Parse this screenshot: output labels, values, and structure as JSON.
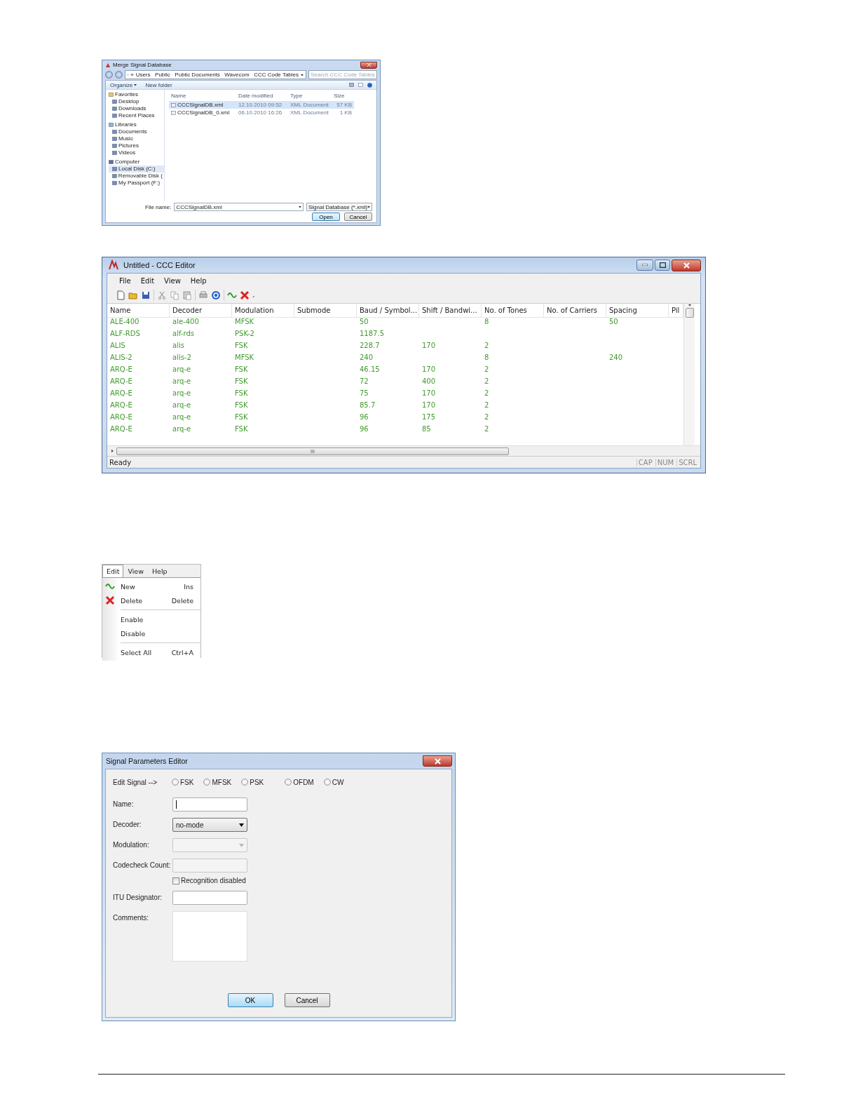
{
  "merge_dialog": {
    "title": "Merge Signal Database",
    "path": [
      "«",
      "Users",
      "Public",
      "Public Documents",
      "Wavecom",
      "CCC Code Tables"
    ],
    "search": {
      "placeholder": "Search CCC Code Tables"
    },
    "toolbar": [
      "Organize",
      "New folder"
    ],
    "nav": [
      {
        "label": "Favorites",
        "children": [
          {
            "label": "Desktop",
            "selected": false
          },
          {
            "label": "Downloads",
            "selected": false
          },
          {
            "label": "Recent Places",
            "selected": false
          }
        ]
      },
      {
        "label": "Libraries",
        "children": [
          {
            "label": "Documents",
            "selected": false
          },
          {
            "label": "Music",
            "selected": false
          },
          {
            "label": "Pictures",
            "selected": false
          },
          {
            "label": "Videos",
            "selected": false
          }
        ]
      },
      {
        "label": "Computer",
        "children": [
          {
            "label": "Local Disk (C:)",
            "selected": true
          },
          {
            "label": "Removable Disk (",
            "selected": false
          },
          {
            "label": "My Passport (F:)",
            "selected": false
          }
        ]
      }
    ],
    "columns": [
      "Name",
      "Date modified",
      "Type",
      "Size"
    ],
    "files": [
      {
        "name": "CCCSignalDB.xml",
        "date": "12.10.2010 09:52",
        "type": "XML Document",
        "size": "57 KB",
        "selected": true
      },
      {
        "name": "CCCSignalDB_0.xml",
        "date": "06.10.2010 16:26",
        "type": "XML Document",
        "size": "1 KB",
        "selected": false
      }
    ],
    "file_name_label": "File name:",
    "file_name": "CCCSignalDB.xml",
    "file_type": "Signal Database (*.xml)",
    "buttons": [
      "Open",
      "Cancel"
    ]
  },
  "editor": {
    "title": "Untitled - CCC Editor",
    "menu": [
      "File",
      "Edit",
      "View",
      "Help"
    ],
    "columns": [
      "Name",
      "Decoder",
      "Modulation",
      "Submode",
      "Baud / Symbol...",
      "Shift / Bandwi...",
      "No. of Tones",
      "No. of Carriers",
      "Spacing",
      "Pil"
    ],
    "rows": [
      [
        "ALE-400",
        "ale-400",
        "MFSK",
        "",
        "50",
        "",
        "8",
        "",
        "50",
        ""
      ],
      [
        "ALF-RDS",
        "alf-rds",
        "PSK-2",
        "",
        "1187.5",
        "",
        "",
        "",
        "",
        ""
      ],
      [
        "ALIS",
        "alis",
        "FSK",
        "",
        "228.7",
        "170",
        "2",
        "",
        "",
        ""
      ],
      [
        "ALIS-2",
        "alis-2",
        "MFSK",
        "",
        "240",
        "",
        "8",
        "",
        "240",
        ""
      ],
      [
        "ARQ-E",
        "arq-e",
        "FSK",
        "",
        "46.15",
        "170",
        "2",
        "",
        "",
        ""
      ],
      [
        "ARQ-E",
        "arq-e",
        "FSK",
        "",
        "72",
        "400",
        "2",
        "",
        "",
        ""
      ],
      [
        "ARQ-E",
        "arq-e",
        "FSK",
        "",
        "75",
        "170",
        "2",
        "",
        "",
        ""
      ],
      [
        "ARQ-E",
        "arq-e",
        "FSK",
        "",
        "85.7",
        "170",
        "2",
        "",
        "",
        ""
      ],
      [
        "ARQ-E",
        "arq-e",
        "FSK",
        "",
        "96",
        "175",
        "2",
        "",
        "",
        ""
      ],
      [
        "ARQ-E",
        "arq-e",
        "FSK",
        "",
        "96",
        "85",
        "2",
        "",
        "",
        ""
      ]
    ],
    "scroll_grip": "III",
    "status": "Ready",
    "indicators": [
      "CAP",
      "NUM",
      "SCRL"
    ]
  },
  "edit_menu": {
    "menubar": [
      {
        "label": "Edit",
        "selected": true
      },
      {
        "label": "View",
        "selected": false
      },
      {
        "label": "Help",
        "selected": false
      }
    ],
    "items": [
      {
        "kind": "item",
        "label": "New",
        "shortcut": "Ins"
      },
      {
        "kind": "item",
        "label": "Delete",
        "shortcut": "Delete"
      },
      {
        "kind": "separator"
      },
      {
        "kind": "item",
        "label": "Enable"
      },
      {
        "kind": "item",
        "label": "Disable"
      },
      {
        "kind": "separator"
      },
      {
        "kind": "item",
        "label": "Select All",
        "shortcut": "Ctrl+A"
      }
    ]
  },
  "signal_editor": {
    "title": "Signal Parameters Editor",
    "edit_signal_label": "Edit Signal -->",
    "options": [
      {
        "label": "FSK",
        "selected": false
      },
      {
        "label": "MFSK",
        "selected": false
      },
      {
        "label": "PSK",
        "selected": false
      },
      {
        "label": "OFDM",
        "selected": false
      },
      {
        "label": "CW",
        "selected": false
      }
    ],
    "fields": [
      {
        "kind": "text",
        "label": "Name:",
        "disabled": false
      },
      {
        "kind": "select",
        "label": "Decoder:",
        "value": "no-mode",
        "disabled": false
      },
      {
        "kind": "select",
        "label": "Modulation:",
        "disabled": true
      },
      {
        "kind": "text",
        "label": "Codecheck Count:",
        "disabled": true
      },
      {
        "kind": "checkbox",
        "label": "Recognition disabled",
        "checked": false
      },
      {
        "kind": "text",
        "label": "ITU Designator:",
        "disabled": false
      },
      {
        "kind": "textarea",
        "label": "Comments:"
      }
    ],
    "buttons": [
      "OK",
      "Cancel"
    ]
  }
}
